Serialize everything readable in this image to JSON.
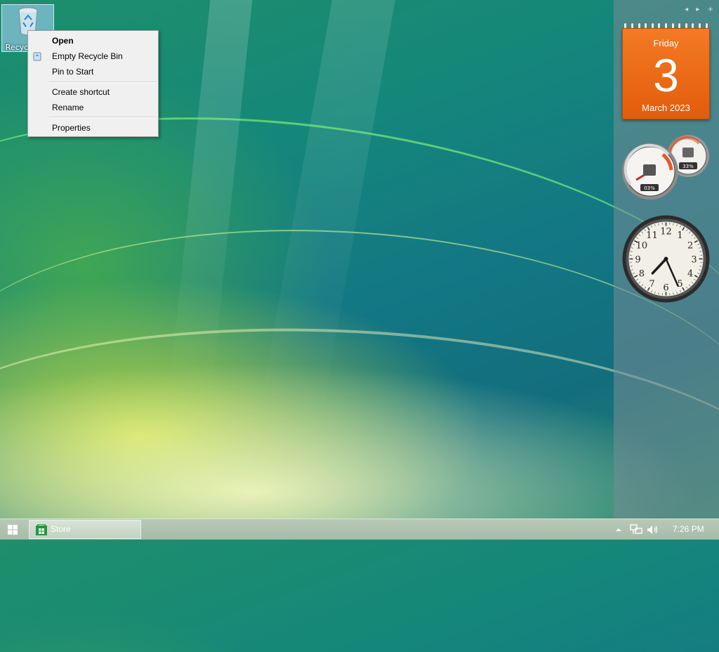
{
  "desktop": {
    "recycle_bin_label": "Recycle Bin"
  },
  "context_menu": {
    "items": [
      {
        "label": "Open",
        "bold": true
      },
      {
        "label": "Empty Recycle Bin"
      },
      {
        "label": "Pin to Start"
      },
      {
        "label": "Create shortcut"
      },
      {
        "label": "Rename"
      },
      {
        "label": "Properties"
      }
    ]
  },
  "sidebar": {
    "controls": [
      "◂",
      "▸",
      "+"
    ],
    "calendar": {
      "day": "Friday",
      "date": "3",
      "month": "March 2023"
    },
    "meters": {
      "cpu": "03%",
      "memory": "33%"
    },
    "clock": {
      "numbers": [
        "12",
        "1",
        "2",
        "3",
        "4",
        "5",
        "6",
        "7",
        "8",
        "9",
        "10",
        "11"
      ],
      "time": "7:26"
    }
  },
  "taskbar": {
    "items": [
      {
        "label": "Store"
      }
    ],
    "clock": "7:26 PM"
  },
  "colors": {
    "calendar": "#e8661a",
    "taskbar": "#b0c3b0"
  }
}
